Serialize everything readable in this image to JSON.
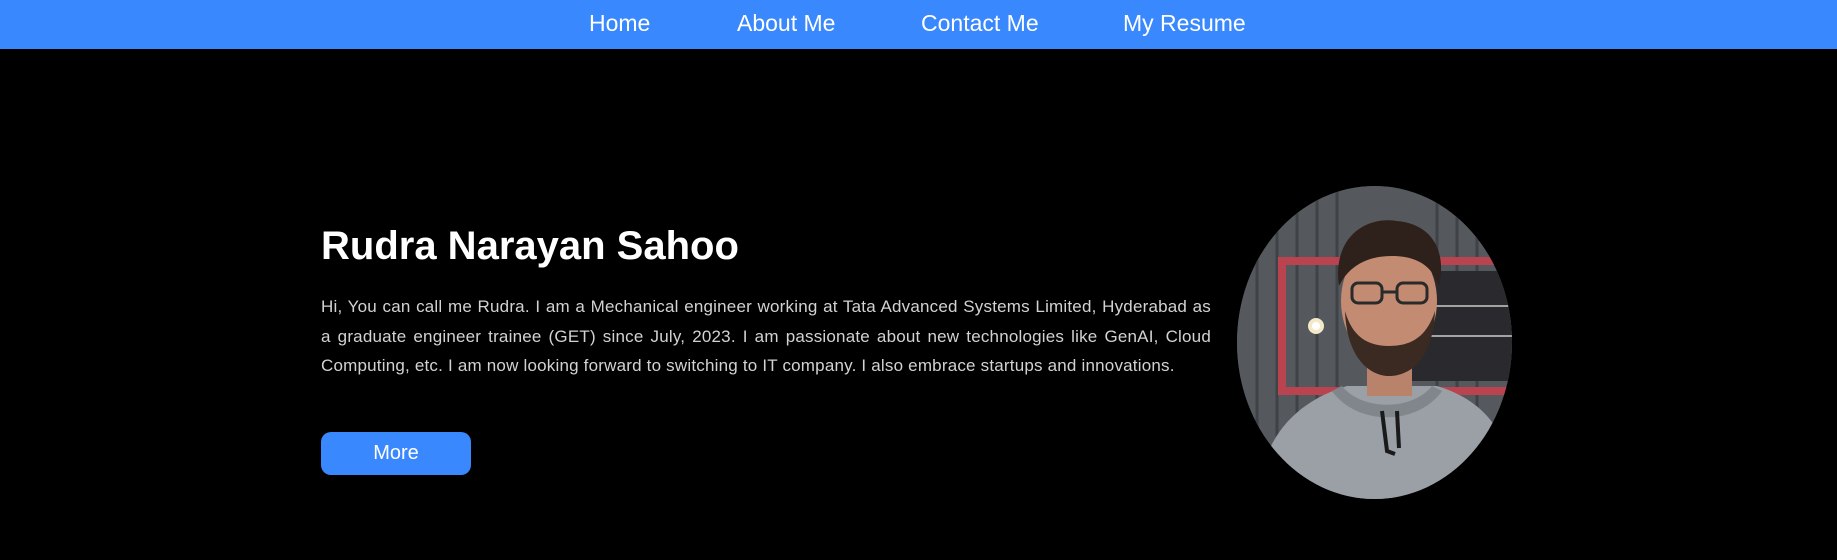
{
  "nav": {
    "items": [
      {
        "label": "Home"
      },
      {
        "label": "About Me"
      },
      {
        "label": "Contact Me"
      },
      {
        "label": "My Resume"
      }
    ]
  },
  "hero": {
    "name": "Rudra Narayan Sahoo",
    "bio": "Hi, You can call me Rudra. I am a Mechanical engineer working at Tata Advanced Systems Limited, Hyderabad as a graduate engineer trainee (GET) since July, 2023. I am passionate about new technologies like GenAI, Cloud Computing, etc. I am now looking forward to switching to IT company. I also embrace startups and innovations.",
    "more_label": "More"
  },
  "colors": {
    "accent": "#3a88fe",
    "background": "#000000",
    "text": "#ffffff",
    "body_text": "#d2d2d2"
  }
}
